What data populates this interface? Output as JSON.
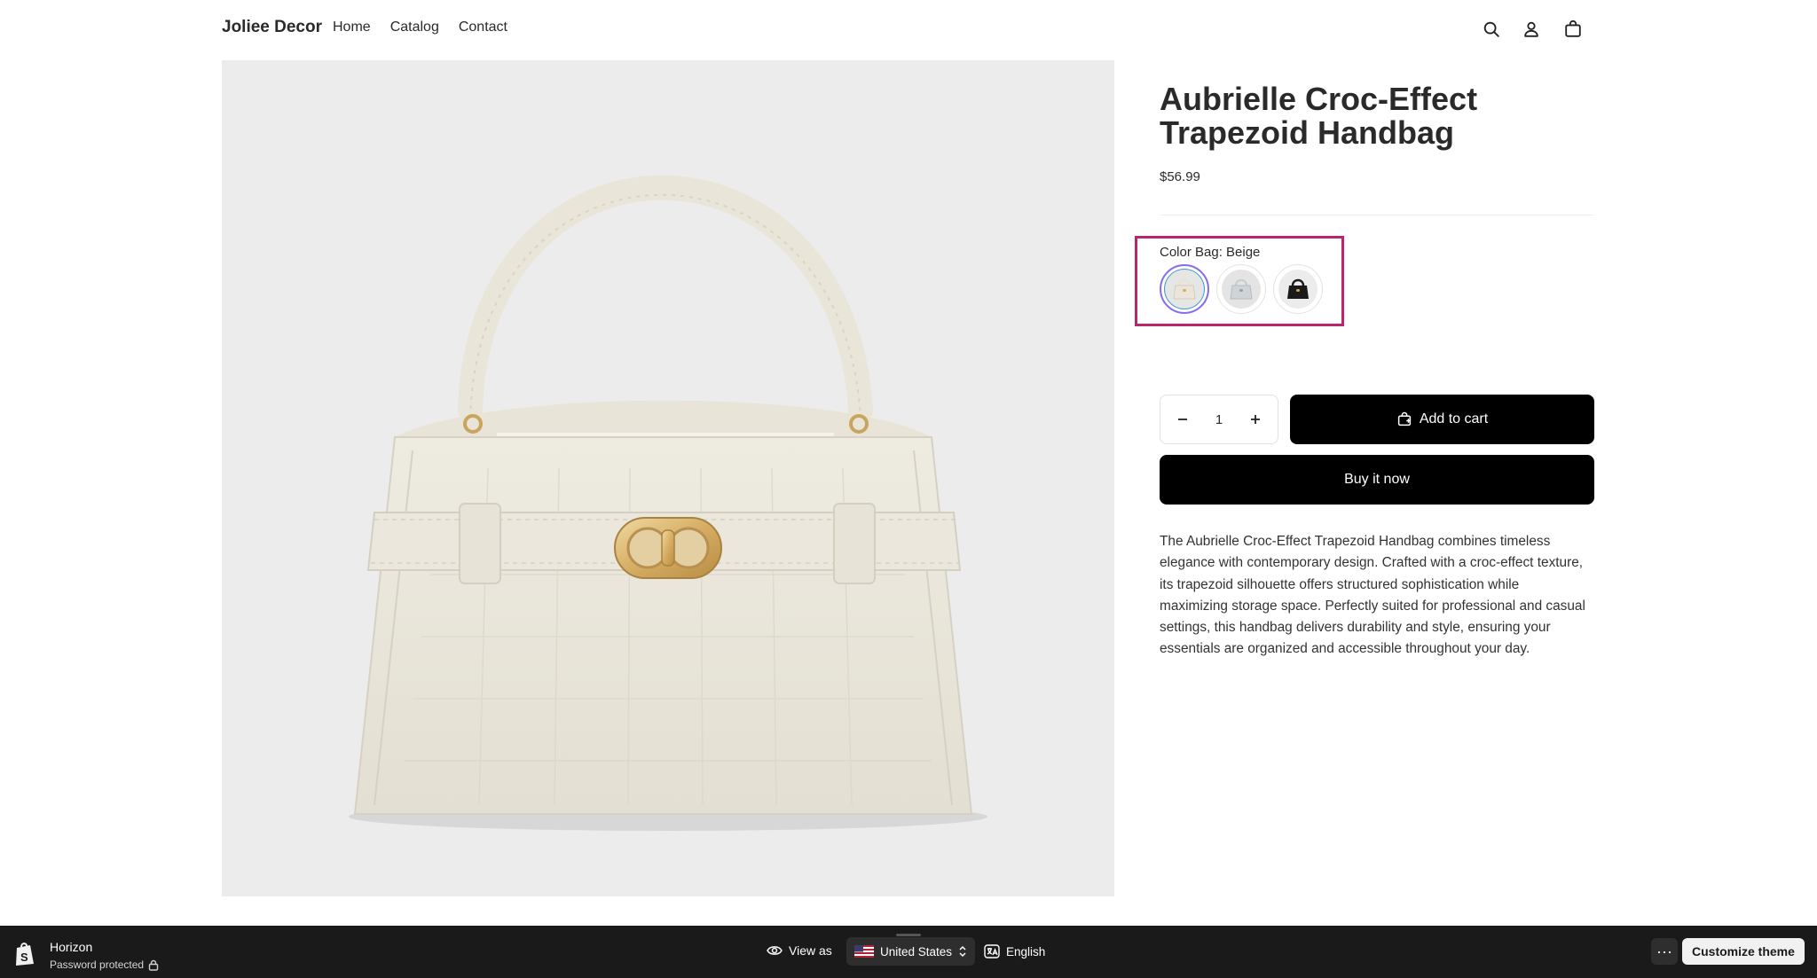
{
  "header": {
    "brand": "Joliee Decor",
    "nav": [
      "Home",
      "Catalog",
      "Contact"
    ],
    "icons": [
      "search-icon",
      "account-icon",
      "cart-icon"
    ]
  },
  "product": {
    "title": "Aubrielle Croc-Effect Trapezoid Handbag",
    "price": "$56.99",
    "variant": {
      "label": "Color Bag: Beige",
      "options": [
        {
          "name": "Beige",
          "color": "#e8e3d6",
          "selected": true
        },
        {
          "name": "Grey",
          "color": "#cfd3d6",
          "selected": false
        },
        {
          "name": "Black",
          "color": "#1a1a1a",
          "selected": false
        }
      ]
    },
    "quantity": "1",
    "add_to_cart": "Add to cart",
    "buy_now": "Buy it now",
    "description": "The Aubrielle Croc-Effect Trapezoid Handbag combines timeless elegance with contemporary design. Crafted with a croc-effect texture, its trapezoid silhouette offers structured sophistication while maximizing storage space. Perfectly suited for professional and casual settings, this handbag delivers durability and style, ensuring your essentials are organized and accessible throughout your day."
  },
  "adminbar": {
    "theme_name": "Horizon",
    "status": "Password protected",
    "view_as": "View as",
    "country": "United States",
    "language": "English",
    "more": "···",
    "customize": "Customize theme"
  },
  "colors": {
    "highlight_border": "#b8276a",
    "button_bg": "#000000",
    "media_bg": "#ececec",
    "admin_bg": "#1a1a1a"
  }
}
